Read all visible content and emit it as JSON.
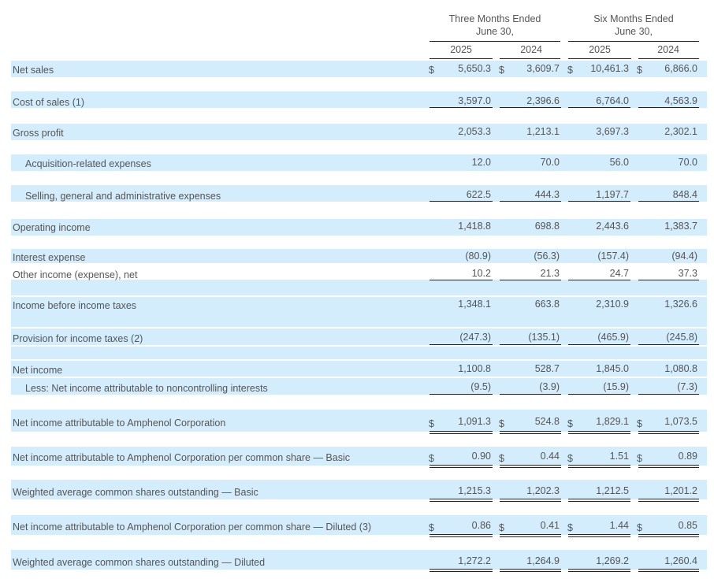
{
  "header": {
    "group1_line1": "Three Months Ended",
    "group1_line2": "June 30,",
    "group2_line1": "Six Months Ended",
    "group2_line2": "June 30,",
    "years": [
      "2025",
      "2024",
      "2025",
      "2024"
    ]
  },
  "currency_symbol": "$",
  "rows": [
    {
      "label": "Net sales",
      "values": [
        "5,650.3",
        "3,609.7",
        "10,461.3",
        "6,866.0"
      ]
    },
    {
      "label": "Cost of sales (1)",
      "values": [
        "3,597.0",
        "2,396.6",
        "6,764.0",
        "4,563.9"
      ]
    },
    {
      "label": "Gross profit",
      "values": [
        "2,053.3",
        "1,213.1",
        "3,697.3",
        "2,302.1"
      ]
    },
    {
      "label": "Acquisition-related expenses",
      "values": [
        "12.0",
        "70.0",
        "56.0",
        "70.0"
      ]
    },
    {
      "label": "Selling, general and administrative expenses",
      "values": [
        "622.5",
        "444.3",
        "1,197.7",
        "848.4"
      ]
    },
    {
      "label": "Operating income",
      "values": [
        "1,418.8",
        "698.8",
        "2,443.6",
        "1,383.7"
      ]
    },
    {
      "label": "Interest expense",
      "values": [
        "(80.9)",
        "(56.3)",
        "(157.4)",
        "(94.4)"
      ]
    },
    {
      "label": "Other income (expense), net",
      "values": [
        "10.2",
        "21.3",
        "24.7",
        "37.3"
      ]
    },
    {
      "label": "Income before income taxes",
      "values": [
        "1,348.1",
        "663.8",
        "2,310.9",
        "1,326.6"
      ]
    },
    {
      "label": "Provision for income taxes (2)",
      "values": [
        "(247.3)",
        "(135.1)",
        "(465.9)",
        "(245.8)"
      ]
    },
    {
      "label": "Net income",
      "values": [
        "1,100.8",
        "528.7",
        "1,845.0",
        "1,080.8"
      ]
    },
    {
      "label": "Less: Net income attributable to noncontrolling interests",
      "values": [
        "(9.5)",
        "(3.9)",
        "(15.9)",
        "(7.3)"
      ]
    },
    {
      "label": "Net income attributable to Amphenol Corporation",
      "values": [
        "1,091.3",
        "524.8",
        "1,829.1",
        "1,073.5"
      ]
    },
    {
      "label": "Net income attributable to Amphenol Corporation per common share — Basic",
      "values": [
        "0.90",
        "0.44",
        "1.51",
        "0.89"
      ]
    },
    {
      "label": "Weighted average common shares outstanding — Basic",
      "values": [
        "1,215.3",
        "1,202.3",
        "1,212.5",
        "1,201.2"
      ]
    },
    {
      "label": "Net income attributable to Amphenol Corporation per common share — Diluted (3)",
      "values": [
        "0.86",
        "0.41",
        "1.44",
        "0.85"
      ]
    },
    {
      "label": "Weighted average common shares outstanding — Diluted",
      "values": [
        "1,272.2",
        "1,264.9",
        "1,269.2",
        "1,260.4"
      ]
    }
  ]
}
